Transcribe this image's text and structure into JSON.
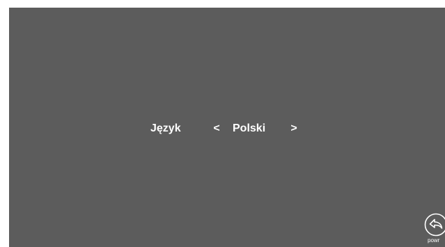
{
  "settings": {
    "language_label": "Język",
    "prev_symbol": "<",
    "language_value": "Polski",
    "next_symbol": ">"
  },
  "back_button": {
    "icon": "back-arrow-icon",
    "label": "powr"
  },
  "colors": {
    "screen_background": "#5c5c5c",
    "text": "#ffffff"
  }
}
